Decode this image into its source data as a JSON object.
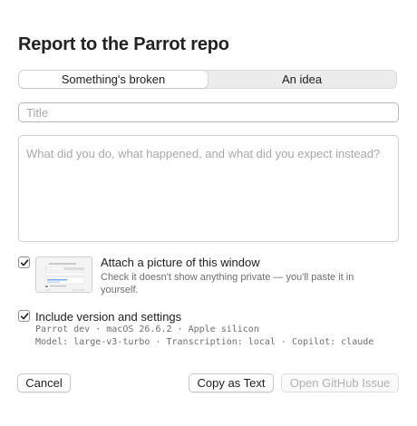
{
  "dialog": {
    "title": "Report to the Parrot repo"
  },
  "tabs": [
    {
      "label": "Something's broken",
      "selected": true
    },
    {
      "label": "An idea",
      "selected": false
    }
  ],
  "form": {
    "title_placeholder": "Title",
    "title_value": "",
    "description_placeholder": "What did you do, what happened, and what did you expect instead?",
    "description_value": ""
  },
  "attach_picture": {
    "checked": true,
    "label": "Attach a picture of this window",
    "hint": "Check it doesn't show anything private — you'll paste it in yourself."
  },
  "include_version": {
    "checked": true,
    "label": "Include version and settings",
    "info_line_1": "Parrot dev · macOS 26.6.2 · Apple silicon",
    "info_line_2": "Model: large-v3-turbo · Transcription: local · Copilot: claude"
  },
  "buttons": {
    "cancel": "Cancel",
    "copy_text": "Copy as Text",
    "open_issue": "Open GitHub Issue"
  },
  "colors": {
    "accent": "#0a84ff",
    "check": "#1d1d1f"
  }
}
